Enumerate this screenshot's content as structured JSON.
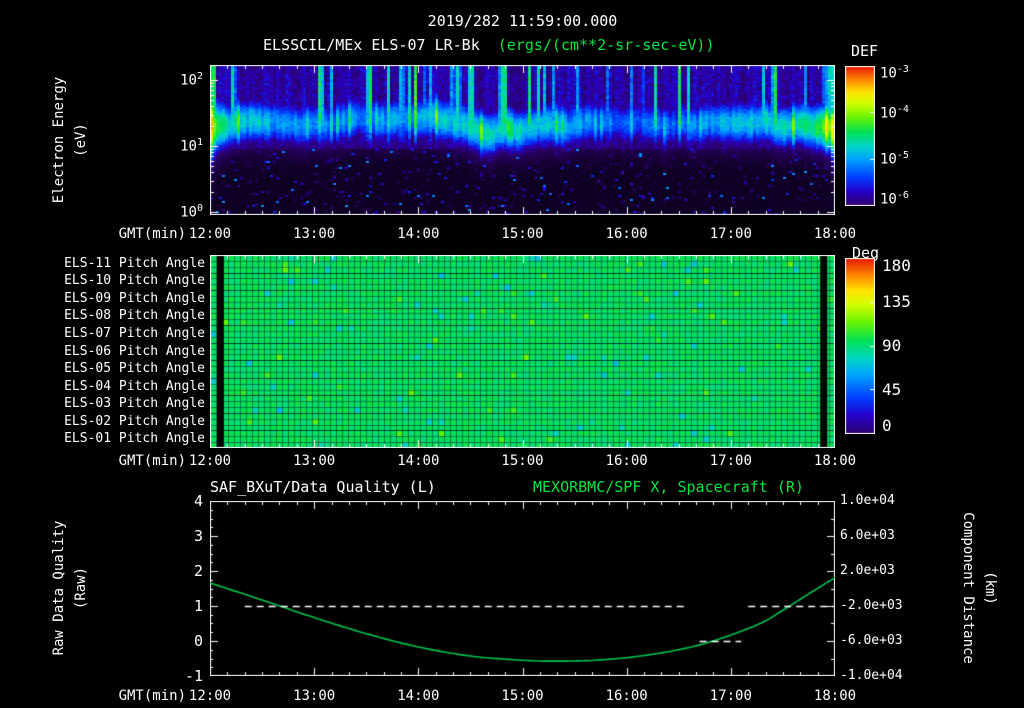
{
  "header": {
    "timestamp": "2019/282 11:59:00.000",
    "instrument_title": "ELSSCIL/MEx ELS-07 LR-Bk",
    "units": "(ergs/(cm**2-sr-sec-eV))"
  },
  "axes": {
    "x_label": "GMT(min)",
    "x_ticks": [
      "12:00",
      "13:00",
      "14:00",
      "15:00",
      "16:00",
      "17:00",
      "18:00"
    ]
  },
  "spectrogram_panel": {
    "y_label_line1": "Electron Energy",
    "y_label_line2": "(eV)",
    "y_ticks": [
      "10^2",
      "10^1",
      "10^0"
    ],
    "colorbar_title": "DEF",
    "colorbar_ticks": [
      "10^-3",
      "10^-4",
      "10^-5",
      "10^-6"
    ]
  },
  "pitch_panel": {
    "row_labels": [
      "ELS-11 Pitch Angle",
      "ELS-10 Pitch Angle",
      "ELS-09 Pitch Angle",
      "ELS-08 Pitch Angle",
      "ELS-07 Pitch Angle",
      "ELS-06 Pitch Angle",
      "ELS-05 Pitch Angle",
      "ELS-04 Pitch Angle",
      "ELS-03 Pitch Angle",
      "ELS-02 Pitch Angle",
      "ELS-01 Pitch Angle"
    ],
    "colorbar_title": "Deg",
    "colorbar_ticks": [
      "180",
      "135",
      "90",
      "45",
      "0"
    ]
  },
  "line_panel": {
    "title_left": "SAF_BXuT/Data Quality (L)",
    "title_right": "MEXORBMC/SPF X, Spacecraft (R)",
    "y_label_left_line1": "Raw Data Quality",
    "y_label_left_line2": "(Raw)",
    "y_ticks_left": [
      "4",
      "3",
      "2",
      "1",
      "0",
      "-1"
    ],
    "y_label_right_line1": "Component Distance",
    "y_label_right_line2": "(km)",
    "y_ticks_right": [
      "1.0e+04",
      "6.0e+03",
      "2.0e+03",
      "-2.0e+03",
      "-6.0e+03",
      "-1.0e+04"
    ]
  },
  "colors": {
    "background": "#000000",
    "text": "#ffffff",
    "accent_green": "#00e63e",
    "curve_green": "#00c24d"
  },
  "chart_data": [
    {
      "type": "heatmap",
      "name": "electron-energy-spectrogram",
      "title": "ELSSCIL/MEx ELS-07 LR-Bk",
      "z_label": "DEF",
      "z_units": "ergs/(cm**2-sr-sec-eV)",
      "z_range_log10": [
        -6,
        -3
      ],
      "x_label": "GMT(min)",
      "x_ticks": [
        "12:00",
        "13:00",
        "14:00",
        "15:00",
        "16:00",
        "17:00",
        "18:00"
      ],
      "x_range_minutes": [
        0,
        360
      ],
      "y_label": "Electron Energy (eV)",
      "y_scale": "log",
      "y_ticks_ev": [
        1,
        10,
        100
      ],
      "y_range_log10_ev": [
        -0.045,
        2.227
      ],
      "summary": "Persistent electron flux band near 15-40 eV at ~1e-4.5 to 1e-4; brightens toward ~1e-3.5 near 12:00 and 17:40-18:00; intermittent vertical enhancements 13:30-14:35 reaching ~100 eV; flux below ~6 eV and well above the band near or below 1e-5.9.",
      "band_model": {
        "center_log10_ev": 1.33,
        "sigma_log10": 0.27,
        "base_log10_flux": -6.9,
        "typical_amplitude": 2.5,
        "upper_bg_log10_flux": -5.9
      },
      "streak_interval_minutes": [
        88,
        155
      ],
      "seed": 1234
    },
    {
      "type": "heatmap",
      "name": "pitch-angle-panels",
      "rows": [
        "ELS-11",
        "ELS-10",
        "ELS-09",
        "ELS-08",
        "ELS-07",
        "ELS-06",
        "ELS-05",
        "ELS-04",
        "ELS-03",
        "ELS-02",
        "ELS-01"
      ],
      "z_label": "Deg",
      "z_range_deg": [
        0,
        180
      ],
      "typical_value_deg": 94,
      "data_gaps_minutes": [
        [
          4,
          8
        ],
        [
          351.5,
          355.5
        ]
      ],
      "x_range_minutes": [
        0,
        360
      ],
      "seed": 77
    },
    {
      "type": "line",
      "name": "quality-and-spacecraft-distance",
      "x_label": "GMT(min)",
      "x_ticks": [
        "12:00",
        "13:00",
        "14:00",
        "15:00",
        "16:00",
        "17:00",
        "18:00"
      ],
      "x_range_minutes": [
        0,
        360
      ],
      "left_axis": {
        "label": "Raw Data Quality (Raw)",
        "range": [
          -1,
          4
        ]
      },
      "right_axis": {
        "label": "Component Distance (km)",
        "range": [
          -10000,
          10000
        ]
      },
      "series": [
        {
          "name": "MEXORBMC/SPF X, Spacecraft (R)",
          "axis": "right",
          "style": "solid",
          "color_key": "curve_green",
          "points_t_minutes": [
            0,
            30,
            60,
            90,
            120,
            150,
            180,
            200,
            225,
            255,
            285,
            315,
            330,
            345,
            360
          ],
          "points_km": [
            640,
            -1320,
            -3320,
            -5160,
            -6680,
            -7720,
            -8200,
            -8300,
            -8160,
            -7520,
            -6280,
            -4160,
            -2480,
            -600,
            1240
          ]
        },
        {
          "name": "SAF_BXuT/Data Quality (L)",
          "axis": "left",
          "style": "dashed",
          "color_key": "text",
          "segments": [
            {
              "t_start": 20,
              "t_end": 274,
              "value": 1
            },
            {
              "t_start": 282,
              "t_end": 306,
              "value": 0
            },
            {
              "t_start": 310,
              "t_end": 360,
              "value": 1
            }
          ]
        }
      ]
    }
  ]
}
